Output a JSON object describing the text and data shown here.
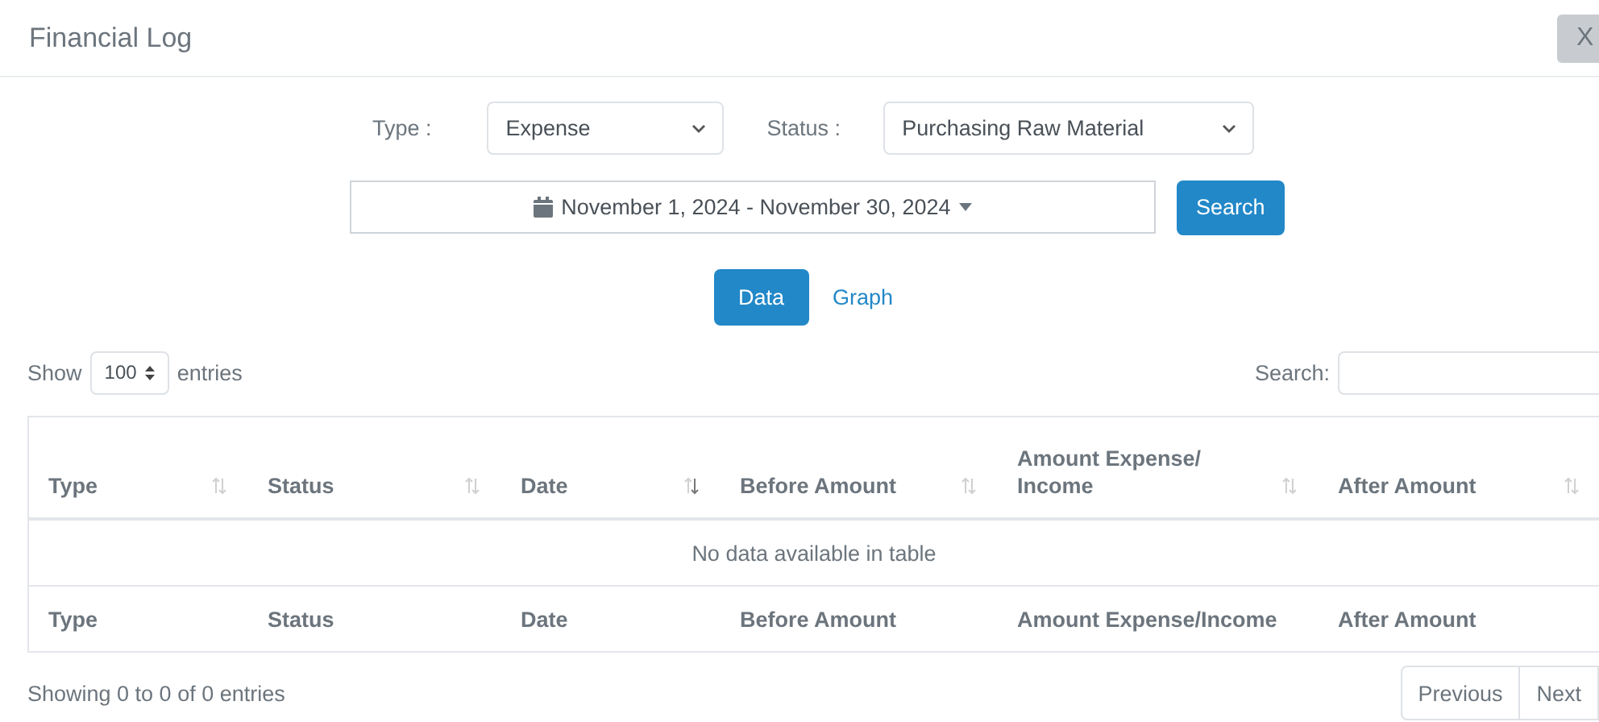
{
  "modal": {
    "title": "Financial Log",
    "close_label": "X"
  },
  "filters": {
    "type_label": "Type :",
    "type_value": "Expense",
    "status_label": "Status :",
    "status_value": "Purchasing Raw Material",
    "date_range": "November 1, 2024 - November 30, 2024",
    "search_button": "Search"
  },
  "view_tabs": [
    {
      "label": "Data",
      "selected": true
    },
    {
      "label": "Graph",
      "selected": false
    }
  ],
  "table_controls": {
    "show_label": "Show",
    "entries_value": "100",
    "entries_label": "entries",
    "search_label": "Search:"
  },
  "table": {
    "columns": [
      {
        "label": "Type",
        "sorted": false
      },
      {
        "label": "Status",
        "sorted": false
      },
      {
        "label": "Date",
        "sorted": true
      },
      {
        "label": "Before Amount",
        "sorted": false
      },
      {
        "label": "Amount Expense/ Income",
        "sorted": false
      },
      {
        "label": "After Amount",
        "sorted": false
      }
    ],
    "empty_message": "No data available in table",
    "footer": [
      "Type",
      "Status",
      "Date",
      "Before Amount",
      "Amount Expense/Income",
      "After Amount"
    ]
  },
  "info": "Showing 0 to 0 of 0 entries",
  "pager": [
    "Previous",
    "Next"
  ]
}
